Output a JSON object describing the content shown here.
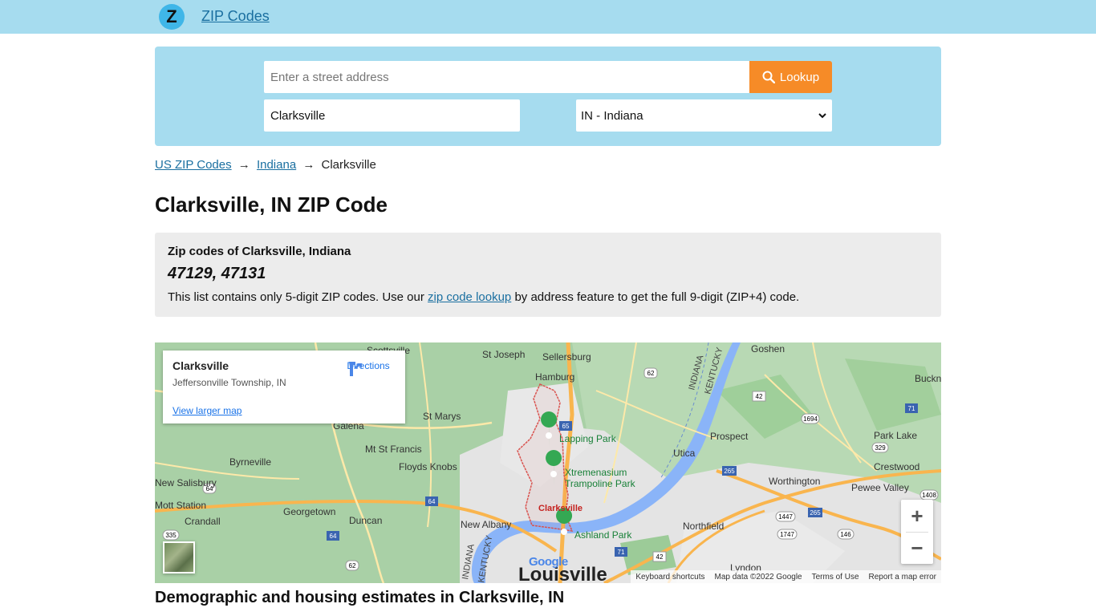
{
  "header": {
    "logo_letter": "Z",
    "brand": "ZIP Codes"
  },
  "search": {
    "address_placeholder": "Enter a street address",
    "lookup_label": "Lookup",
    "city_value": "Clarksville",
    "state_value": "IN - Indiana"
  },
  "breadcrumb": {
    "items": [
      "US ZIP Codes",
      "Indiana"
    ],
    "current": "Clarksville",
    "separator": "→"
  },
  "page_title": "Clarksville, IN ZIP Code",
  "zip_section": {
    "label": "Zip codes of Clarksville, Indiana",
    "codes": "47129, 47131",
    "note_before": "This list contains only 5-digit ZIP codes. Use our ",
    "note_link": "zip code lookup",
    "note_after": " by address feature to get the full 9-digit (ZIP+4) code."
  },
  "map": {
    "card": {
      "title": "Clarksville",
      "subtitle": "Jeffersonville Township, IN",
      "directions": "Directions",
      "larger_map": "View larger map"
    },
    "zoom_in": "+",
    "zoom_out": "−",
    "google": "Google",
    "footer": [
      "Keyboard shortcuts",
      "Map data ©2022 Google",
      "Terms of Use",
      "Report a map error"
    ],
    "places": [
      "Scottsville",
      "St Joseph",
      "Sellersburg",
      "Goshen",
      "Hamburg",
      "Buckner",
      "Galena",
      "St Marys",
      "Mt St Francis",
      "Floyds Knobs",
      "Byrneville",
      "New Salisbury",
      "Mott Station",
      "Georgetown",
      "Crandall",
      "Duncan",
      "New Albany",
      "Lapping Park",
      "Xtremenasium",
      "Trampoline Park",
      "Clarksville",
      "Ashland Park",
      "Utica",
      "Prospect",
      "Park Lake",
      "Crestwood",
      "Worthington",
      "Pewee Valley",
      "Northfield",
      "Lyndon",
      "Louisville",
      "INDIANA",
      "KENTUCKY"
    ],
    "shields": [
      "62",
      "42",
      "1694",
      "71",
      "65",
      "329",
      "265",
      "1408",
      "64",
      "335",
      "64",
      "64",
      "62",
      "1447",
      "1747",
      "146",
      "42",
      "71",
      "265"
    ]
  },
  "demographics_heading": "Demographic and housing estimates in Clarksville, IN",
  "colors": {
    "header_bg": "#a6dcef",
    "accent": "#f68b27",
    "link": "#1a6fa0",
    "zip_box_bg": "#ececec"
  }
}
